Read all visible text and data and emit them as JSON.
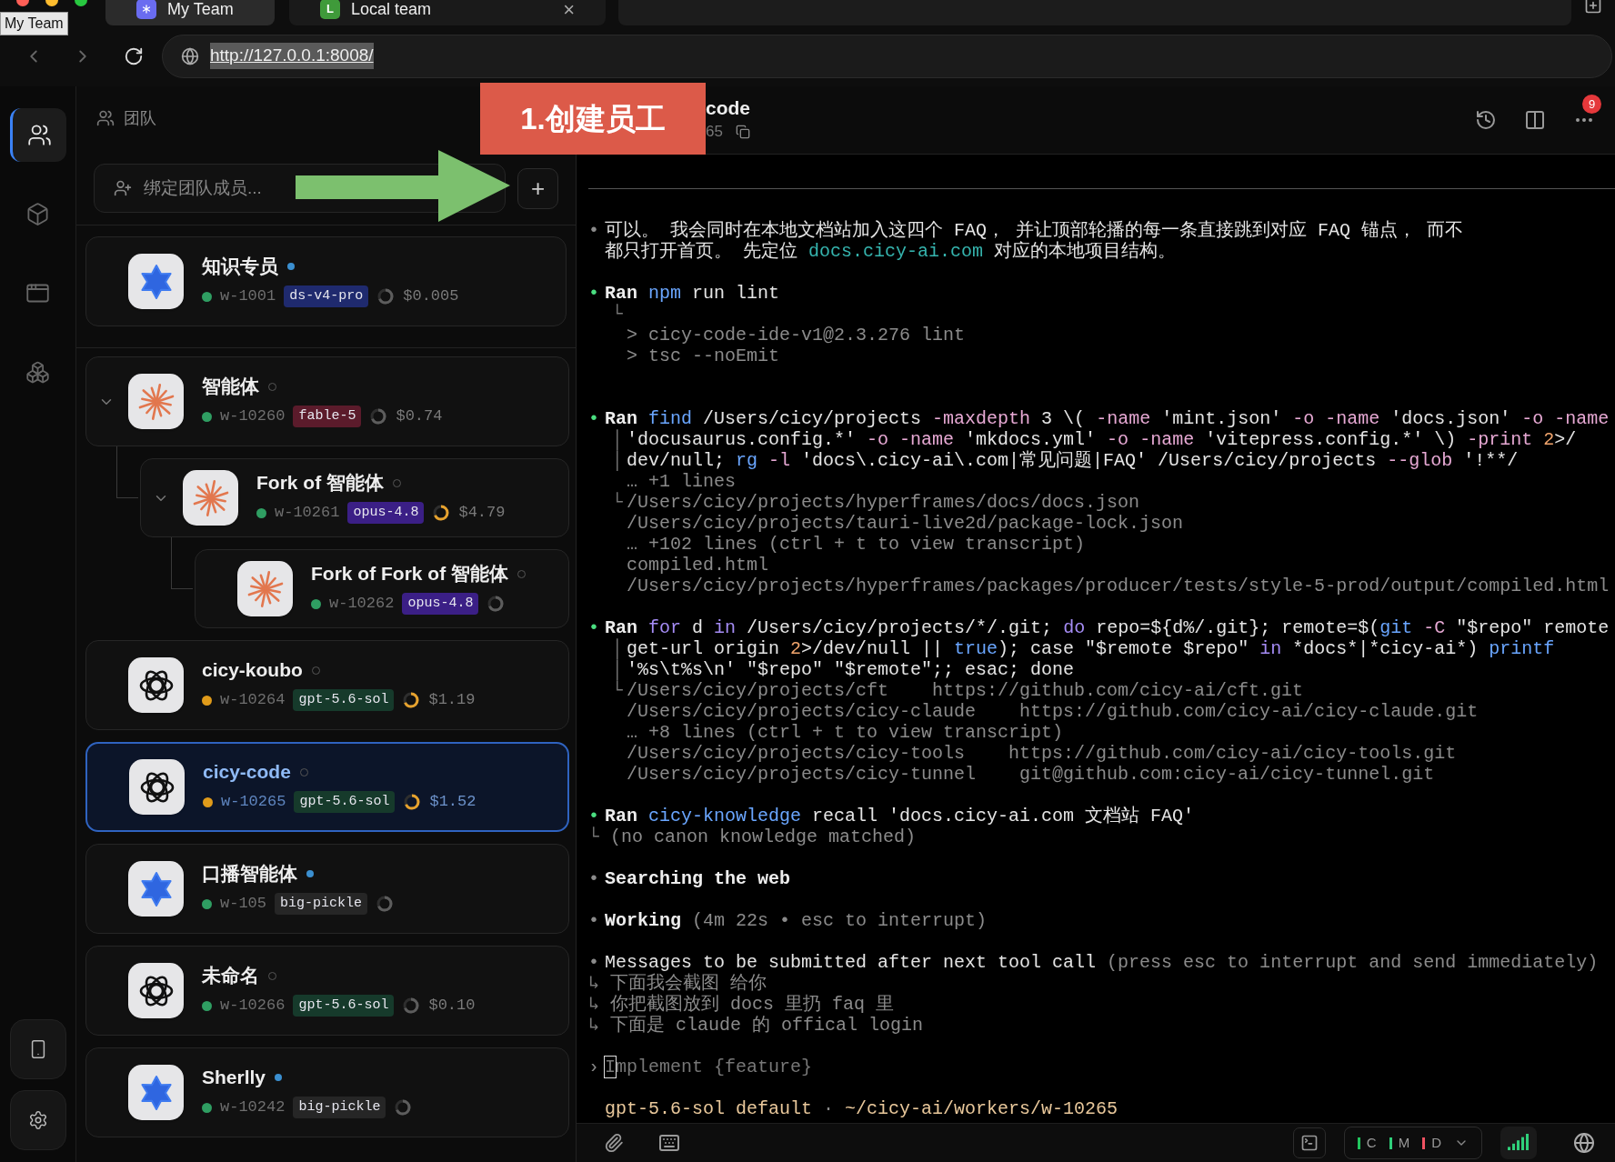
{
  "browser": {
    "tooltip": "My Team",
    "url": "http://127.0.0.1:8008/",
    "tabs": [
      {
        "label": "My Team",
        "kind": "star",
        "selected": false
      },
      {
        "label": "Local team",
        "kind": "letter",
        "letter": "L",
        "close": "×",
        "selected": true
      }
    ]
  },
  "annotation": {
    "label": "1.创建员工"
  },
  "rail": {
    "items": [
      {
        "kind": "users",
        "selected": true
      },
      {
        "kind": "cube",
        "selected": false
      },
      {
        "kind": "window",
        "selected": false
      },
      {
        "kind": "cubes",
        "selected": false
      }
    ],
    "bottom": [
      {
        "kind": "phone"
      },
      {
        "kind": "gear"
      }
    ]
  },
  "panel": {
    "title": "团队",
    "search": {
      "placeholder": "绑定团队成员..."
    },
    "add": "+",
    "pinned": [
      {
        "name": "知识专员",
        "online": true,
        "kind": "star",
        "color": "#2f9e62",
        "id": "w-1001",
        "model": {
          "text": "ds-v4-pro",
          "color": "#1f2a6e"
        },
        "busy": false,
        "cost": "$0.005",
        "selected": false
      }
    ],
    "members": [
      {
        "name": "智能体",
        "online": false,
        "kind": "burst",
        "color": "#2f9e62",
        "id": "w-10260",
        "model": {
          "text": "fable-5",
          "color": "#5b1b2b"
        },
        "busy": false,
        "cost": "$0.74",
        "selected": false,
        "expanded": true,
        "children": [
          {
            "name": "Fork of 智能体",
            "online": false,
            "kind": "burst",
            "color": "#2f9e62",
            "id": "w-10261",
            "model": {
              "text": "opus-4.8",
              "color": "#3b1f86"
            },
            "busy": true,
            "cost": "$4.79",
            "selected": false,
            "expanded": true,
            "children": [
              {
                "name": "Fork of Fork of 智能体",
                "online": false,
                "kind": "burst",
                "color": "#2f9e62",
                "id": "w-10262",
                "model": {
                  "text": "opus-4.8",
                  "color": "#3b1f86"
                },
                "busy": false,
                "selected": false
              }
            ]
          }
        ]
      },
      {
        "name": "cicy-koubo",
        "online": false,
        "kind": "knot",
        "color": "#e09b1a",
        "id": "w-10264",
        "model": {
          "text": "gpt-5.6-sol",
          "color": "#163a2b"
        },
        "busy": true,
        "cost": "$1.19",
        "selected": false
      },
      {
        "name": "cicy-code",
        "online": false,
        "kind": "knot",
        "color": "#e09b1a",
        "id": "w-10265",
        "model": {
          "text": "gpt-5.6-sol",
          "color": "#163a2b"
        },
        "busy": true,
        "cost": "$1.52",
        "selected": true
      },
      {
        "name": "口播智能体",
        "online": true,
        "kind": "star",
        "color": "#2f9e62",
        "id": "w-105",
        "model": {
          "text": "big-pickle",
          "color": "#262626"
        },
        "busy": false,
        "selected": false
      },
      {
        "name": "未命名",
        "online": false,
        "kind": "knot",
        "color": "#2f9e62",
        "id": "w-10266",
        "model": {
          "text": "gpt-5.6-sol",
          "color": "#163a2b"
        },
        "busy": false,
        "cost": "$0.10",
        "selected": false
      },
      {
        "name": "Sherlly",
        "online": true,
        "kind": "star",
        "color": "#2f9e62",
        "id": "w-10242",
        "model": {
          "text": "big-pickle",
          "color": "#262626"
        },
        "busy": false,
        "selected": false
      }
    ]
  },
  "header": {
    "title": "code",
    "subtitle": "65",
    "badge": "9"
  },
  "terminal": {
    "blocks": [
      {
        "kind": "first",
        "lines": [
          {
            "kind": "bullet",
            "marker": "•",
            "color": "#8b8b8b",
            "segs": [
              {
                "kind": "plain",
                "text": "可以。 我会同时在本地文档站加入这四个 FAQ， 并让顶部轮播的每一条直接跳到对应 FAQ 锚点， 而不"
              }
            ]
          },
          {
            "kind": "wrap",
            "segs": [
              {
                "kind": "plain",
                "text": "都只打开首页。 先定位 "
              },
              {
                "kind": "link",
                "text": "docs.cicy-ai.com"
              },
              {
                "kind": "plain",
                "text": " 对应的本地项目结构。"
              }
            ]
          }
        ]
      },
      {
        "kind": "spaced",
        "lines": [
          {
            "kind": "bullet",
            "marker": "•",
            "color": "#4ade80",
            "segs": [
              {
                "kind": "head",
                "text": "Ran"
              },
              {
                "kind": "cmd",
                "text": " npm"
              },
              {
                "kind": "plain",
                "text": " run lint"
              }
            ]
          },
          {
            "kind": "cont",
            "prefix": "└"
          },
          {
            "kind": "cont",
            "segs": [
              {
                "kind": "dim",
                "text": "> cicy-code-ide-v1@2.3.276 lint"
              }
            ]
          },
          {
            "kind": "cont",
            "segs": [
              {
                "kind": "dim",
                "text": "> tsc --noEmit"
              }
            ]
          }
        ]
      },
      {
        "kind": "wide",
        "lines": [
          {
            "kind": "bullet",
            "marker": "•",
            "color": "#4ade80",
            "segs": [
              {
                "kind": "head",
                "text": "Ran"
              },
              {
                "kind": "cmd",
                "text": " find"
              },
              {
                "kind": "plain",
                "text": " /Users/cicy/projects "
              },
              {
                "kind": "flag",
                "text": "-maxdepth"
              },
              {
                "kind": "plain",
                "text": " 3 \\( "
              },
              {
                "kind": "flag",
                "text": "-name"
              },
              {
                "kind": "plain",
                "text": " 'mint.json' "
              },
              {
                "kind": "flag",
                "text": "-o"
              },
              {
                "kind": "flag",
                "text": " -name"
              },
              {
                "kind": "plain",
                "text": " 'docs.json' "
              },
              {
                "kind": "flag",
                "text": "-o"
              },
              {
                "kind": "flag",
                "text": " -name"
              }
            ]
          },
          {
            "kind": "cont",
            "prefix": "│",
            "segs": [
              {
                "kind": "plain",
                "text": "'docusaurus.config.*' "
              },
              {
                "kind": "flag",
                "text": "-o"
              },
              {
                "kind": "flag",
                "text": " -name"
              },
              {
                "kind": "plain",
                "text": " 'mkdocs.yml' "
              },
              {
                "kind": "flag",
                "text": "-o"
              },
              {
                "kind": "flag",
                "text": " -name"
              },
              {
                "kind": "plain",
                "text": " 'vitepress.config.*' \\) "
              },
              {
                "kind": "flag",
                "text": "-print"
              },
              {
                "kind": "num",
                "text": " 2"
              },
              {
                "kind": "plain",
                "text": ">/"
              }
            ]
          },
          {
            "kind": "cont",
            "prefix": "│",
            "segs": [
              {
                "kind": "plain",
                "text": "dev/null; "
              },
              {
                "kind": "cmd",
                "text": "rg"
              },
              {
                "kind": "flag",
                "text": " -l"
              },
              {
                "kind": "plain",
                "text": " 'docs\\.cicy-ai\\.com|常见问题|FAQ' /Users/cicy/projects "
              },
              {
                "kind": "flag",
                "text": "--glob"
              },
              {
                "kind": "plain",
                "text": " '!**/"
              }
            ]
          },
          {
            "kind": "cont",
            "segs": [
              {
                "kind": "dim",
                "text": "… +1 lines"
              }
            ]
          },
          {
            "kind": "cont",
            "prefix": "└",
            "segs": [
              {
                "kind": "dim",
                "text": "/Users/cicy/projects/hyperframes/docs/docs.json"
              }
            ]
          },
          {
            "kind": "cont",
            "segs": [
              {
                "kind": "dim",
                "text": "/Users/cicy/projects/tauri-live2d/package-lock.json"
              }
            ]
          },
          {
            "kind": "cont",
            "segs": [
              {
                "kind": "dim",
                "text": "… +102 lines (ctrl + t to view transcript)"
              }
            ]
          },
          {
            "kind": "cont",
            "segs": [
              {
                "kind": "dim",
                "text": "compiled.html"
              }
            ]
          },
          {
            "kind": "cont",
            "segs": [
              {
                "kind": "dim",
                "text": "/Users/cicy/projects/hyperframes/packages/producer/tests/style-5-prod/output/compiled.html"
              }
            ]
          }
        ]
      },
      {
        "kind": "spaced",
        "lines": [
          {
            "kind": "bullet",
            "marker": "•",
            "color": "#4ade80",
            "segs": [
              {
                "kind": "head",
                "text": "Ran"
              },
              {
                "kind": "kw",
                "text": " for"
              },
              {
                "kind": "plain",
                "text": " d "
              },
              {
                "kind": "kw",
                "text": "in"
              },
              {
                "kind": "plain",
                "text": " /Users/cicy/projects/*/.git; "
              },
              {
                "kind": "kw",
                "text": "do"
              },
              {
                "kind": "plain",
                "text": " repo=${d%/.git}; remote=$("
              },
              {
                "kind": "cmd",
                "text": "git"
              },
              {
                "kind": "flag",
                "text": " -C"
              },
              {
                "kind": "plain",
                "text": " \"$repo\" remote"
              }
            ]
          },
          {
            "kind": "cont",
            "prefix": "│",
            "segs": [
              {
                "kind": "plain",
                "text": "get-url origin "
              },
              {
                "kind": "num",
                "text": "2"
              },
              {
                "kind": "plain",
                "text": ">/dev/null || "
              },
              {
                "kind": "cmd",
                "text": "true"
              },
              {
                "kind": "plain",
                "text": "); case \"$remote $repo\" "
              },
              {
                "kind": "kw",
                "text": "in"
              },
              {
                "kind": "plain",
                "text": " *docs*|*cicy-ai*) "
              },
              {
                "kind": "cmd",
                "text": "printf"
              }
            ]
          },
          {
            "kind": "cont",
            "prefix": "│",
            "segs": [
              {
                "kind": "plain",
                "text": "'%s\\t%s\\n' \"$repo\" \"$remote\";; esac; done"
              }
            ]
          },
          {
            "kind": "cont",
            "prefix": "└",
            "segs": [
              {
                "kind": "dim",
                "text": "/Users/cicy/projects/cft    https://github.com/cicy-ai/cft.git"
              }
            ]
          },
          {
            "kind": "cont",
            "segs": [
              {
                "kind": "dim",
                "text": "/Users/cicy/projects/cicy-claude    https://github.com/cicy-ai/cicy-claude.git"
              }
            ]
          },
          {
            "kind": "cont",
            "segs": [
              {
                "kind": "dim",
                "text": "… +8 lines (ctrl + t to view transcript)"
              }
            ]
          },
          {
            "kind": "cont",
            "segs": [
              {
                "kind": "dim",
                "text": "/Users/cicy/projects/cicy-tools    https://github.com/cicy-ai/cicy-tools.git"
              }
            ]
          },
          {
            "kind": "cont",
            "segs": [
              {
                "kind": "dim",
                "text": "/Users/cicy/projects/cicy-tunnel    git@github.com:cicy-ai/cicy-tunnel.git"
              }
            ]
          }
        ]
      },
      {
        "kind": "spaced",
        "lines": [
          {
            "kind": "bullet",
            "marker": "•",
            "color": "#4ade80",
            "segs": [
              {
                "kind": "head",
                "text": "Ran"
              },
              {
                "kind": "cmd",
                "text": " cicy-knowledge"
              },
              {
                "kind": "plain",
                "text": " recall 'docs.cicy-ai.com 文档站 FAQ'"
              }
            ]
          },
          {
            "kind": "wrap",
            "prefix": "└",
            "segs": [
              {
                "kind": "dim",
                "text": "(no canon knowledge matched)"
              }
            ]
          }
        ]
      },
      {
        "kind": "spaced",
        "lines": [
          {
            "kind": "bullet",
            "marker": "•",
            "color": "#8b8b8b",
            "segs": [
              {
                "kind": "head",
                "text": "Searching the web"
              }
            ]
          }
        ]
      },
      {
        "kind": "spaced",
        "lines": [
          {
            "kind": "bullet",
            "marker": "•",
            "color": "#8b8b8b",
            "segs": [
              {
                "kind": "head",
                "text": "Working"
              },
              {
                "kind": "dim",
                "text": " (4m 22s • esc to interrupt)"
              }
            ]
          }
        ]
      },
      {
        "kind": "spaced",
        "lines": [
          {
            "kind": "bullet",
            "marker": "•",
            "color": "#8b8b8b",
            "segs": [
              {
                "kind": "plain",
                "text": "Messages to be submitted after next tool call"
              },
              {
                "kind": "dim",
                "text": " (press esc to interrupt and send immediately)"
              }
            ]
          },
          {
            "kind": "wrap",
            "prefix": "↳",
            "segs": [
              {
                "kind": "dim",
                "text": "下面我会截图 给你"
              }
            ]
          },
          {
            "kind": "wrap",
            "prefix": "↳",
            "segs": [
              {
                "kind": "dim",
                "text": "你把截图放到 docs 里扔 faq 里"
              }
            ]
          },
          {
            "kind": "wrap",
            "prefix": "↳",
            "segs": [
              {
                "kind": "dim",
                "text": "下面是 claude 的 offical login"
              }
            ]
          }
        ]
      },
      {
        "kind": "spaced",
        "lines": [
          {
            "kind": "input",
            "marker": "›",
            "color": "#8b8b8b",
            "placeholder": "Implement {feature}"
          }
        ]
      },
      {
        "kind": "spaced",
        "lines": [
          {
            "kind": "bullet",
            "segs": [
              {
                "kind": "prompt",
                "text": "gpt-5.6-sol default"
              },
              {
                "kind": "dim",
                "text": " · "
              },
              {
                "kind": "prompt",
                "text": "~/cicy-ai/workers/w-10265"
              }
            ]
          }
        ]
      }
    ]
  },
  "footer": {
    "meters": [
      {
        "label": "C",
        "color": "#22c55e"
      },
      {
        "label": "M",
        "color": "#2fd07a"
      },
      {
        "label": "D",
        "color": "#f05262"
      }
    ]
  }
}
